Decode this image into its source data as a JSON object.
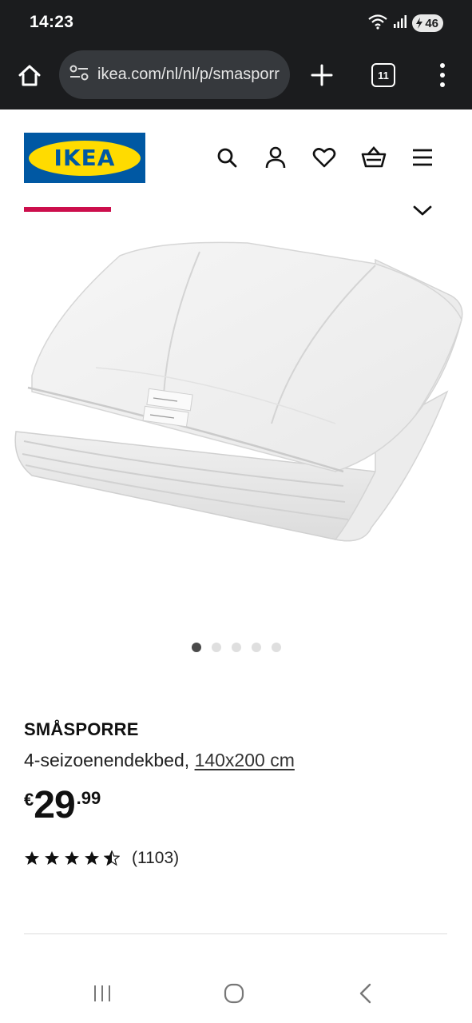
{
  "status_bar": {
    "time": "14:23",
    "battery": "46",
    "icons": [
      "wifi-icon",
      "signal-icon",
      "battery-icon"
    ]
  },
  "browser": {
    "url": "ikea.com/nl/nl/p/smasporr",
    "tab_count": "11",
    "icons": [
      "home-icon",
      "site-settings-icon",
      "new-tab-plus-icon",
      "tabs-icon",
      "more-vert-icon"
    ]
  },
  "header": {
    "logo_text": "IKEA",
    "icons": [
      "search-icon",
      "account-icon",
      "favourites-heart-icon",
      "shopping-bag-icon",
      "hamburger-menu-icon"
    ],
    "accent_color": "#cc0e4c",
    "scroll_progress": 1.0
  },
  "gallery": {
    "image_alt": "white duvet folded",
    "slide_count": 5,
    "active_index": 0
  },
  "product": {
    "name": "SMÅSPORRE",
    "description": "4-seizoenendekbed,",
    "size_link": "140x200 cm",
    "price_currency": "€",
    "price_integer": "29",
    "price_decimal": ".99",
    "rating": 4.5,
    "reviews": "(1103)"
  },
  "nav": {
    "icons": [
      "recent-apps-icon",
      "home-circle-icon",
      "back-icon"
    ]
  },
  "colors": {
    "ikea_blue": "#0058a3",
    "ikea_yellow": "#ffdb00",
    "dark_bar": "#1b1c1e"
  }
}
